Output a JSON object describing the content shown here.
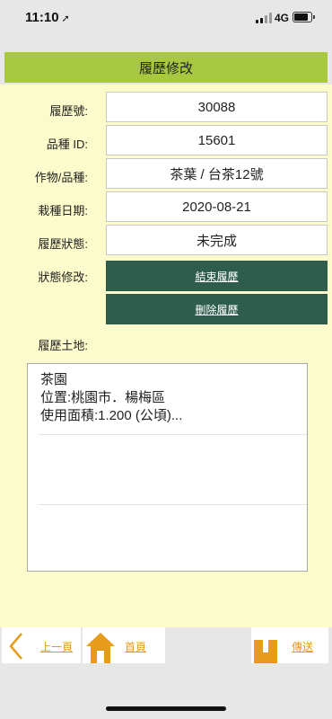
{
  "status": {
    "time": "11:10",
    "network": "4G"
  },
  "title": "履歷修改",
  "form": {
    "record_no_label": "履歷號:",
    "record_no": "30088",
    "variety_id_label": "品種 ID:",
    "variety_id": "15601",
    "crop_label": "作物/品種:",
    "crop": "茶葉 / 台茶12號",
    "plant_date_label": "栽種日期:",
    "plant_date": "2020-08-21",
    "record_status_label": "履歷狀態:",
    "record_status": "未完成",
    "status_change_label": "狀態修改:",
    "end_record_button": "結束履歷",
    "delete_record_button": "刪除履歷",
    "land_label": "履歷土地:"
  },
  "land_list": [
    {
      "name": "茶園",
      "location": "位置:桃園市．楊梅區",
      "area": "使用面積:1.200 (公頃)..."
    }
  ],
  "bottom_nav": {
    "prev_label": "上一頁",
    "home_label": "首頁",
    "send_label": "傳送"
  },
  "colors": {
    "title_bar": "#a8c842",
    "panel": "#fcfbcb",
    "action": "#2e5d4e",
    "nav_accent": "#e69b1d"
  }
}
